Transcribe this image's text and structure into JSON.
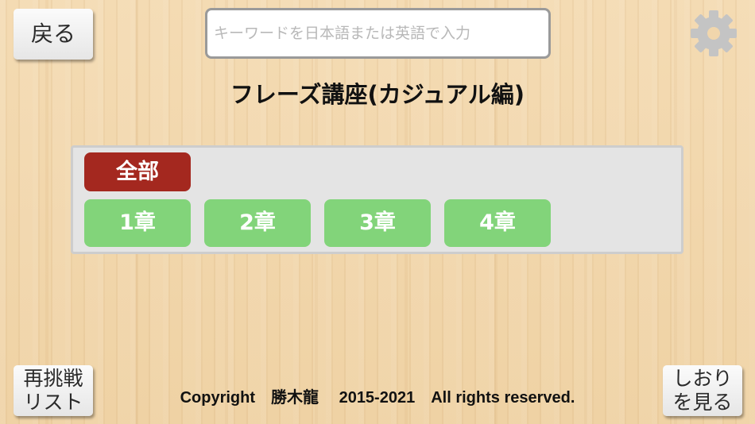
{
  "header": {
    "back_label": "戻る",
    "search_placeholder": "キーワードを日本語または英語で入力",
    "settings_icon": "gear-icon"
  },
  "page_title": "フレーズ講座(カジュアル編)",
  "chapter_panel": {
    "all_label": "全部",
    "chapters": [
      "1章",
      "2章",
      "3章",
      "4章"
    ],
    "colors": {
      "all_button": "#a4281f",
      "chapter_button": "#82d47a"
    }
  },
  "footer": {
    "retry_label_line1": "再挑戦",
    "retry_label_line2": "リスト",
    "copyright": "Copyright　勝木龍　 2015-2021　All rights reserved.",
    "bookmark_label_line1": "しおり",
    "bookmark_label_line2": "を見る"
  }
}
